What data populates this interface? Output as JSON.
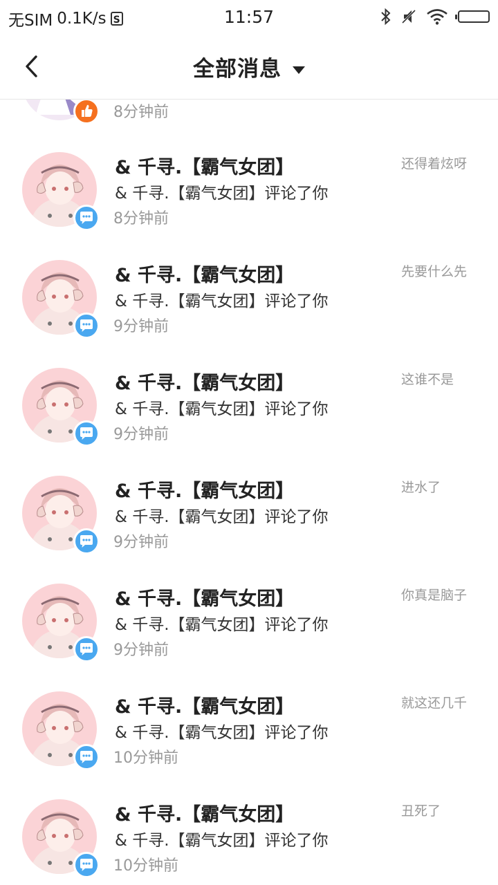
{
  "status_bar": {
    "carrier": "无SIM",
    "speed": "0.1K/s",
    "sim_icon_text": "S",
    "time": "11:57"
  },
  "header": {
    "title": "全部消息"
  },
  "partial_item": {
    "time": "8分钟前",
    "badge": "like"
  },
  "items": [
    {
      "name": "& 千寻.【霸气女团】",
      "action": "& 千寻.【霸气女团】评论了你",
      "time": "8分钟前",
      "snippet": "还得着炫呀",
      "badge": "comment"
    },
    {
      "name": "& 千寻.【霸气女团】",
      "action": "& 千寻.【霸气女团】评论了你",
      "time": "9分钟前",
      "snippet": "先要什么先",
      "badge": "comment"
    },
    {
      "name": "& 千寻.【霸气女团】",
      "action": "& 千寻.【霸气女团】评论了你",
      "time": "9分钟前",
      "snippet": "这谁不是",
      "badge": "comment"
    },
    {
      "name": "& 千寻.【霸气女团】",
      "action": "& 千寻.【霸气女团】评论了你",
      "time": "9分钟前",
      "snippet": "进水了",
      "badge": "comment"
    },
    {
      "name": "& 千寻.【霸气女团】",
      "action": "& 千寻.【霸气女团】评论了你",
      "time": "9分钟前",
      "snippet": "你真是脑子",
      "badge": "comment"
    },
    {
      "name": "& 千寻.【霸气女团】",
      "action": "& 千寻.【霸气女团】评论了你",
      "time": "10分钟前",
      "snippet": "就这还几千",
      "badge": "comment"
    },
    {
      "name": "& 千寻.【霸气女团】",
      "action": "& 千寻.【霸气女团】评论了你",
      "time": "10分钟前",
      "snippet": "丑死了",
      "badge": "comment"
    }
  ],
  "colors": {
    "comment_badge": "#4aa8f0",
    "like_badge": "#f5701f",
    "avatar_bg": "#fbd3d6"
  }
}
